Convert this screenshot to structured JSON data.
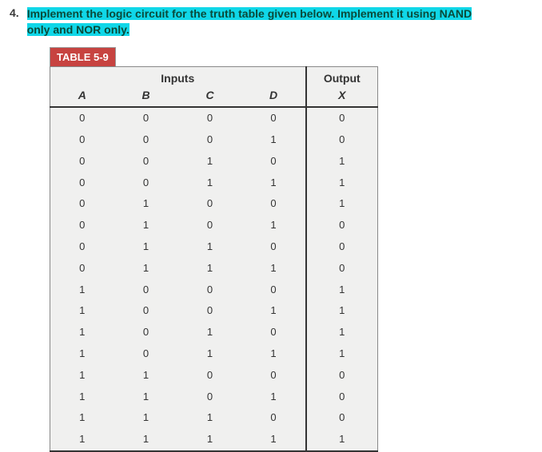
{
  "question": {
    "number": "4.",
    "text_part1": "Implement the logic circuit for the truth table given below. Implement it using NAND",
    "text_part2": "only and NOR only."
  },
  "table_title": "TABLE 5-9",
  "headers": {
    "inputs_label": "Inputs",
    "output_label": "Output",
    "cols": [
      "A",
      "B",
      "C",
      "D"
    ],
    "out_col": "X"
  },
  "chart_data": {
    "type": "table",
    "columns": [
      "A",
      "B",
      "C",
      "D",
      "X"
    ],
    "rows": [
      [
        0,
        0,
        0,
        0,
        0
      ],
      [
        0,
        0,
        0,
        1,
        0
      ],
      [
        0,
        0,
        1,
        0,
        1
      ],
      [
        0,
        0,
        1,
        1,
        1
      ],
      [
        0,
        1,
        0,
        0,
        1
      ],
      [
        0,
        1,
        0,
        1,
        0
      ],
      [
        0,
        1,
        1,
        0,
        0
      ],
      [
        0,
        1,
        1,
        1,
        0
      ],
      [
        1,
        0,
        0,
        0,
        1
      ],
      [
        1,
        0,
        0,
        1,
        1
      ],
      [
        1,
        0,
        1,
        0,
        1
      ],
      [
        1,
        0,
        1,
        1,
        1
      ],
      [
        1,
        1,
        0,
        0,
        0
      ],
      [
        1,
        1,
        0,
        1,
        0
      ],
      [
        1,
        1,
        1,
        0,
        0
      ],
      [
        1,
        1,
        1,
        1,
        1
      ]
    ]
  }
}
